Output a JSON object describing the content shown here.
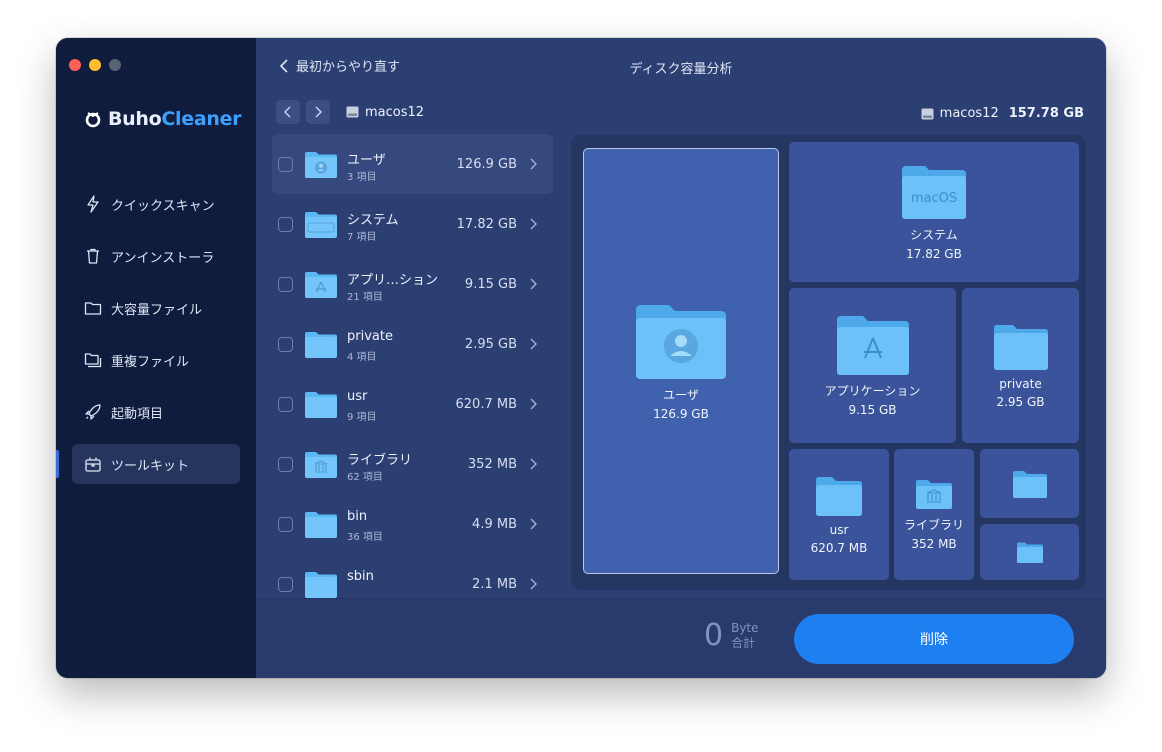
{
  "app": {
    "brand_prefix": "Buho",
    "brand_suffix": "Cleaner"
  },
  "sidebar": {
    "items": [
      {
        "label": "クイックスキャン",
        "icon": "lightning-icon"
      },
      {
        "label": "アンインストーラ",
        "icon": "trash-icon"
      },
      {
        "label": "大容量ファイル",
        "icon": "folder-icon"
      },
      {
        "label": "重複ファイル",
        "icon": "duplicate-folder-icon"
      },
      {
        "label": "起動項目",
        "icon": "rocket-icon"
      },
      {
        "label": "ツールキット",
        "icon": "toolkit-icon",
        "active": true
      }
    ]
  },
  "header": {
    "back_label": "最初からやり直す",
    "title": "ディスク容量分析"
  },
  "path": {
    "disk_name": "macos12"
  },
  "disk": {
    "name": "macos12",
    "size": "157.78 GB"
  },
  "files": [
    {
      "name": "ユーザ",
      "count": "3 項目",
      "size": "126.9 GB",
      "icon": "user-folder-icon"
    },
    {
      "name": "システム",
      "count": "7 項目",
      "size": "17.82 GB",
      "icon": "macos-folder-icon"
    },
    {
      "name": "アプリ…ション",
      "count": "21 項目",
      "size": "9.15 GB",
      "icon": "apps-folder-icon"
    },
    {
      "name": "private",
      "count": "4 項目",
      "size": "2.95 GB",
      "icon": "folder-icon"
    },
    {
      "name": "usr",
      "count": "9 項目",
      "size": "620.7 MB",
      "icon": "folder-icon"
    },
    {
      "name": "ライブラリ",
      "count": "62 項目",
      "size": "352 MB",
      "icon": "library-folder-icon"
    },
    {
      "name": "bin",
      "count": "36 項目",
      "size": "4.9 MB",
      "icon": "folder-icon"
    },
    {
      "name": "sbin",
      "count": "",
      "size": "2.1 MB",
      "icon": "folder-icon"
    }
  ],
  "treemap": {
    "tiles": [
      {
        "name": "ユーザ",
        "size": "126.9 GB"
      },
      {
        "name": "システム",
        "size": "17.82 GB",
        "badge": "macOS"
      },
      {
        "name": "アプリケーション",
        "size": "9.15 GB"
      },
      {
        "name": "private",
        "size": "2.95 GB"
      },
      {
        "name": "usr",
        "size": "620.7 MB"
      },
      {
        "name": "ライブラリ",
        "size": "352 MB"
      }
    ]
  },
  "footer": {
    "total_value": "0",
    "total_unit": "Byte",
    "total_label": "合計",
    "delete_label": "削除"
  },
  "colors": {
    "sidebar_bg": "#0f1c3d",
    "main_bg": "#2b3f72",
    "accent": "#1e7ff0",
    "folder": "#5bb8f5"
  }
}
